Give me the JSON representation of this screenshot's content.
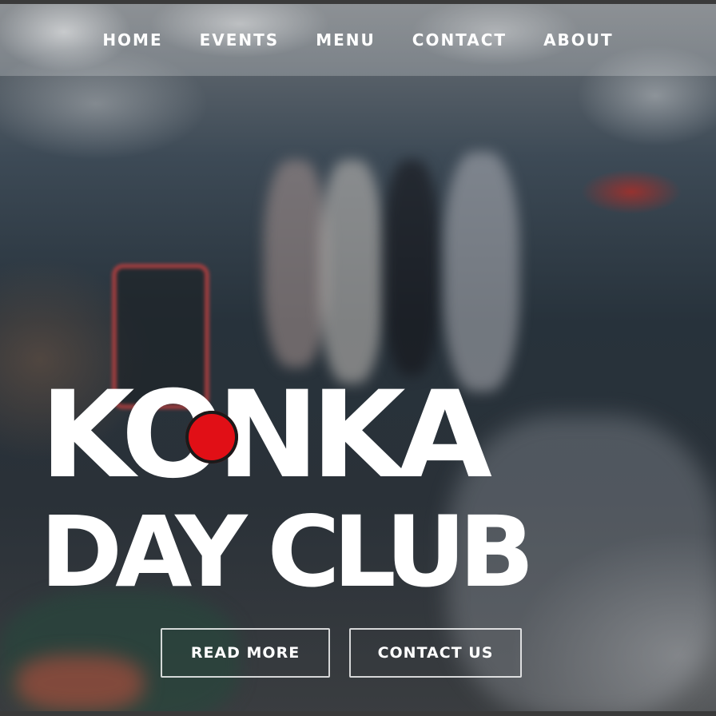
{
  "nav": {
    "items": [
      {
        "label": "HOME"
      },
      {
        "label": "EVENTS"
      },
      {
        "label": "MENU"
      },
      {
        "label": "CONTACT"
      },
      {
        "label": "ABOUT"
      }
    ]
  },
  "hero": {
    "title_line1": "KONKA",
    "title_line2": "DAY CLUB",
    "accent_color": "#e10f16",
    "buttons": {
      "read_more": "READ MORE",
      "contact_us": "CONTACT US"
    }
  }
}
